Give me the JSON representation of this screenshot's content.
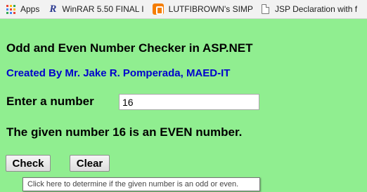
{
  "bookmarks_bar": {
    "items": [
      {
        "label": "Apps",
        "icon": "apps-grid-icon"
      },
      {
        "label": "WinRAR 5.50 FINAL I",
        "icon": "winrar-r-icon"
      },
      {
        "label": "LUTFIBROWN's SIMP",
        "icon": "blogger-icon"
      },
      {
        "label": "JSP Declaration with f",
        "icon": "page-icon"
      }
    ],
    "apps_dot_colors": [
      "#ea4335",
      "#fbbc05",
      "#34a853",
      "#4285f4",
      "#ea4335",
      "#fbbc05",
      "#34a853",
      "#4285f4",
      "#ea4335"
    ]
  },
  "page": {
    "background": "#90ee90",
    "title": "Odd and Even Number Checker in ASP.NET",
    "byline": "Created By Mr. Jake R. Pomperada, MAED-IT",
    "byline_color": "#0000cd",
    "input_label": "Enter a number",
    "input_value": "16",
    "result_text": "The given number 16 is an EVEN number.",
    "check_button": "Check",
    "clear_button": "Clear",
    "tooltip": "Click here to determine if the given number is an odd or even."
  }
}
